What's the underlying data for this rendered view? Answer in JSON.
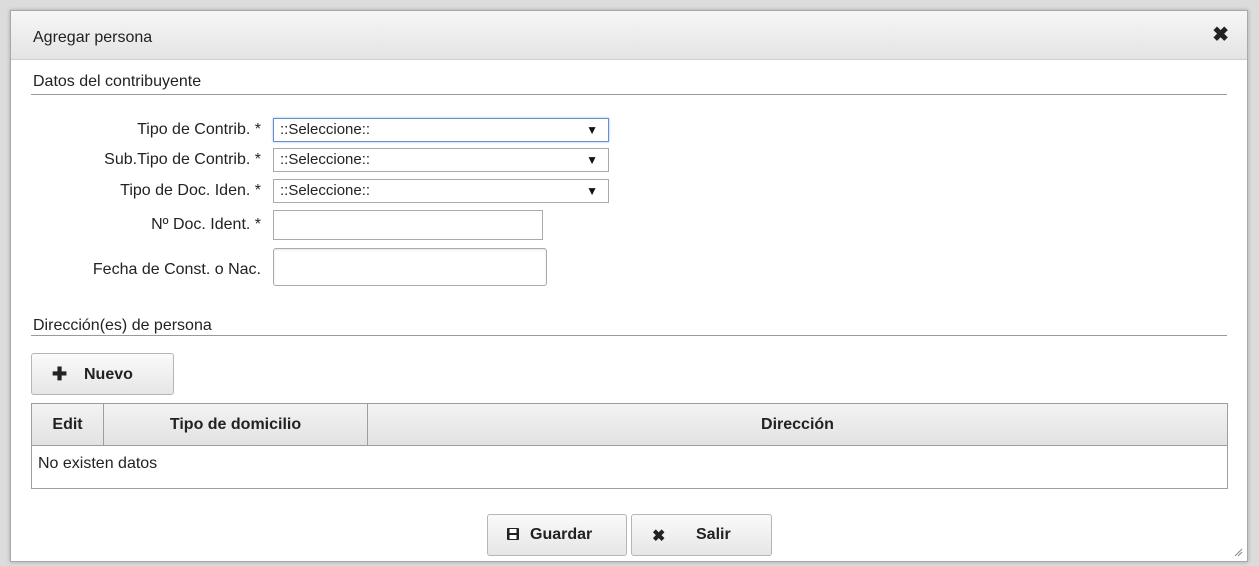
{
  "dialog": {
    "title": "Agregar persona",
    "close_icon": "close-icon"
  },
  "contribuyente": {
    "section_title": "Datos del contribuyente",
    "tipo_contrib": {
      "label": "Tipo de Contrib. *",
      "value": "::Seleccione::"
    },
    "subtipo_contrib": {
      "label": "Sub.Tipo de Contrib. *",
      "value": "::Seleccione::"
    },
    "tipo_doc": {
      "label": "Tipo de Doc. Iden. *",
      "value": "::Seleccione::"
    },
    "num_doc": {
      "label": "Nº Doc. Ident. *",
      "value": ""
    },
    "fecha": {
      "label": "Fecha de Const. o Nac.",
      "value": ""
    }
  },
  "direcciones": {
    "section_title": "Dirección(es) de persona",
    "nuevo_label": "Nuevo",
    "nuevo_icon": "plus-icon",
    "columns": [
      "Edit",
      "Tipo de domicilio",
      "Dirección"
    ],
    "empty_text": "No existen datos"
  },
  "footer": {
    "guardar_label": "Guardar",
    "guardar_icon": "save-icon",
    "salir_label": "Salir",
    "salir_icon": "close-icon"
  },
  "colors": {
    "focus_border": "#6a8fd0",
    "titlebar": "#eeeeee"
  }
}
